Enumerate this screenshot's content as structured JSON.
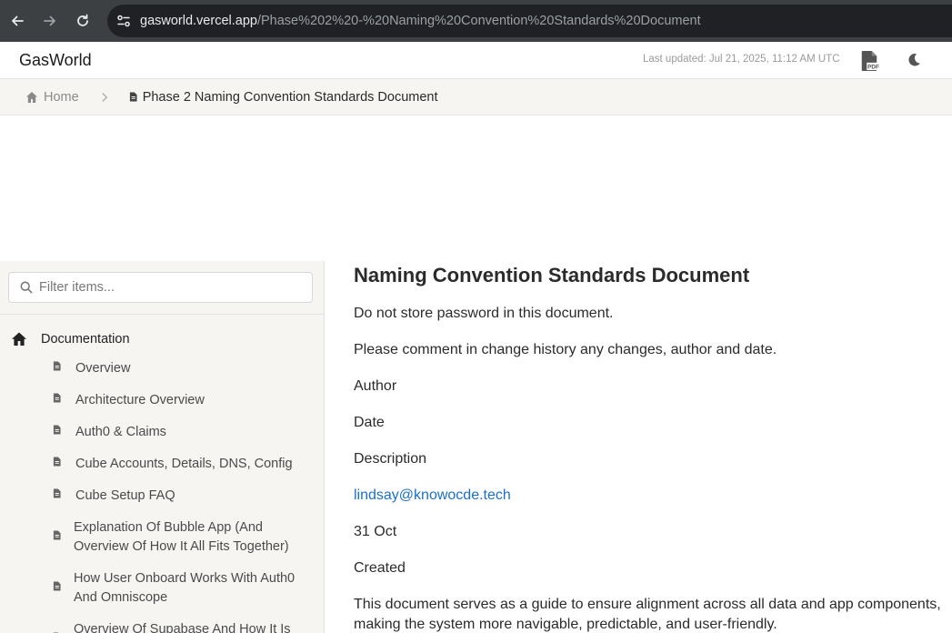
{
  "browser": {
    "url_host": "gasworld.vercel.app",
    "url_path": "/Phase%202%20-%20Naming%20Convention%20Standards%20Document"
  },
  "app": {
    "title": "GasWorld",
    "last_updated": "Last updated: Jul 21, 2025, 11:12 AM UTC",
    "pdf_icon": "pdf-icon",
    "theme_icon": "moon-icon"
  },
  "breadcrumb": {
    "home": "Home",
    "current": "Phase 2 Naming Convention Standards Document"
  },
  "sidebar": {
    "filter_placeholder": "Filter items...",
    "root_label": "Documentation",
    "items": [
      {
        "label": "Overview"
      },
      {
        "label": "Architecture Overview"
      },
      {
        "label": "Auth0 & Claims"
      },
      {
        "label": "Cube Accounts, Details, DNS, Config"
      },
      {
        "label": "Cube Setup FAQ"
      },
      {
        "label": "Explanation Of Bubble App (And Overview Of How It All Fits Together)"
      },
      {
        "label": "How User Onboard Works With Auth0 And Omniscope"
      },
      {
        "label": "Overview Of Supabase And How It Is"
      }
    ]
  },
  "main": {
    "title": "Naming Convention Standards Document",
    "paragraphs": [
      "Do not store password in this document.",
      "Please comment in change history any changes, author and date.",
      "Author",
      "Date",
      "Description"
    ],
    "author_email": "lindsay@knowocde.tech",
    "date_value": "31 Oct",
    "description_value": "Created",
    "intro": "This document serves as a guide to ensure alignment across all data and app components, making the system more navigable, predictable, and user-friendly."
  },
  "colors": {
    "browser_bar": "#3c4043",
    "url_box": "#202124",
    "sidebar_bg": "#f6f5f2",
    "link": "#1a6fd1"
  }
}
